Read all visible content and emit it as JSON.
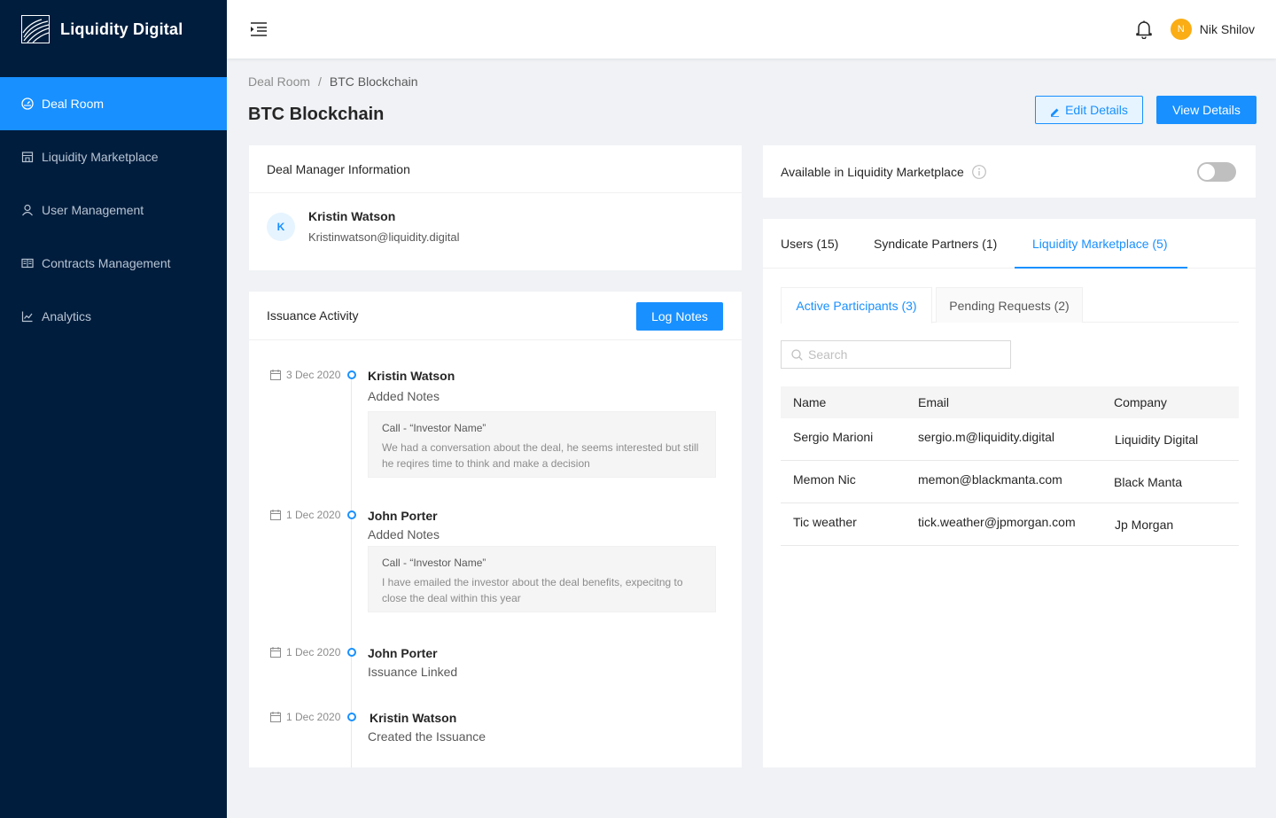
{
  "brand": {
    "name": "Liquidity Digital"
  },
  "sidebar": {
    "items": [
      {
        "label": "Deal Room",
        "icon": "dashboard-icon",
        "active": true
      },
      {
        "label": "Liquidity Marketplace",
        "icon": "shop-icon",
        "active": false
      },
      {
        "label": "User Management",
        "icon": "user-icon",
        "active": false
      },
      {
        "label": "Contracts Management",
        "icon": "book-icon",
        "active": false
      },
      {
        "label": "Analytics",
        "icon": "line-chart-icon",
        "active": false
      }
    ]
  },
  "header": {
    "user_initial": "N",
    "user_name": "Nik Shilov"
  },
  "breadcrumb": {
    "root": "Deal Room",
    "separator": "/",
    "current": "BTC Blockchain"
  },
  "page": {
    "title": "BTC Blockchain",
    "edit_label": "Edit Details",
    "view_label": "View Details"
  },
  "deal_manager": {
    "title": "Deal Manager Information",
    "initial": "K",
    "name": "Kristin Watson",
    "email": "Kristinwatson@liquidity.digital"
  },
  "issuance": {
    "title": "Issuance Activity",
    "log_label": "Log Notes",
    "items": [
      {
        "date": "3 Dec 2020",
        "name": "Kristin Watson",
        "action": "Added Notes",
        "note_title": "Call - “Investor Name”",
        "note_text": "We had a conversation about the deal, he seems interested but still he reqires time to think and make a decision"
      },
      {
        "date": "1 Dec 2020",
        "name": "John Porter",
        "action": "Added Notes",
        "note_title": "Call - “Investor Name”",
        "note_text": "I have emailed the investor about the deal benefits, expecitng to close the deal within this year"
      },
      {
        "date": "1 Dec 2020",
        "name": "John Porter",
        "action": "Issuance Linked"
      },
      {
        "date": "1 Dec 2020",
        "name": "Kristin Watson",
        "action": "Created the Issuance"
      }
    ]
  },
  "availability": {
    "label": "Available in Liquidity Marketplace",
    "enabled": false
  },
  "tabs": [
    {
      "label": "Users (15)",
      "active": false
    },
    {
      "label": "Syndicate Partners (1)",
      "active": false
    },
    {
      "label": "Liquidity Marketplace (5)",
      "active": true
    }
  ],
  "subtabs": [
    {
      "label": "Active Participants (3)",
      "active": true
    },
    {
      "label": "Pending Requests (2)",
      "active": false
    }
  ],
  "search": {
    "placeholder": "Search",
    "value": ""
  },
  "table": {
    "columns": [
      "Name",
      "Email",
      "Company"
    ],
    "rows": [
      [
        "Sergio Marioni",
        "sergio.m@liquidity.digital",
        "Liquidity Digital"
      ],
      [
        "Memon Nic",
        "memon@blackmanta.com",
        "Black Manta"
      ],
      [
        "Tic weather",
        "tick.weather@jpmorgan.com",
        "Jp Morgan"
      ]
    ]
  },
  "colors": {
    "primary": "#1890ff",
    "sidebar": "#001d3d",
    "avatar": "#faad14"
  }
}
